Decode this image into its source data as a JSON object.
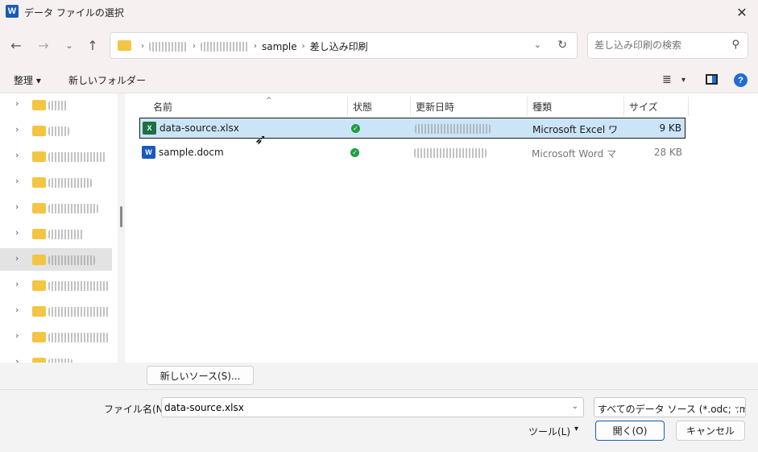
{
  "window": {
    "title": "データ ファイルの選択",
    "app_icon": "W"
  },
  "nav": {
    "crumbs": [
      "sample",
      "差し込み印刷"
    ],
    "search_placeholder": "差し込み印刷の検索"
  },
  "toolbar": {
    "organize_label": "整理 ▾",
    "new_folder_label": "新しいフォルダー",
    "help_label": "?"
  },
  "sidebar": {
    "item_count": 11,
    "selected_index": 6
  },
  "columns": {
    "name": "名前",
    "status": "状態",
    "modified": "更新日時",
    "type": "種類",
    "size": "サイズ"
  },
  "files": [
    {
      "name": "data-source.xlsx",
      "type": "Microsoft Excel ワ",
      "size": "9 KB",
      "icon": "X",
      "selected": true
    },
    {
      "name": "sample.docm",
      "type": "Microsoft Word マ",
      "size": "28 KB",
      "icon": "W",
      "selected": false
    }
  ],
  "buttons": {
    "new_source": "新しいソース(S)...",
    "tools": "ツール(L)",
    "open": "開く(O)",
    "cancel": "キャンセル"
  },
  "filename": {
    "label": "ファイル名(N):",
    "value": "data-source.xlsx"
  },
  "filetype": {
    "value": "すべてのデータ ソース (*.odc;*.mdb"
  },
  "colors": {
    "selected_row": "#cce4f7",
    "folder": "#f4c542",
    "accent": "#185abd",
    "status_ok": "#1e9e45"
  }
}
